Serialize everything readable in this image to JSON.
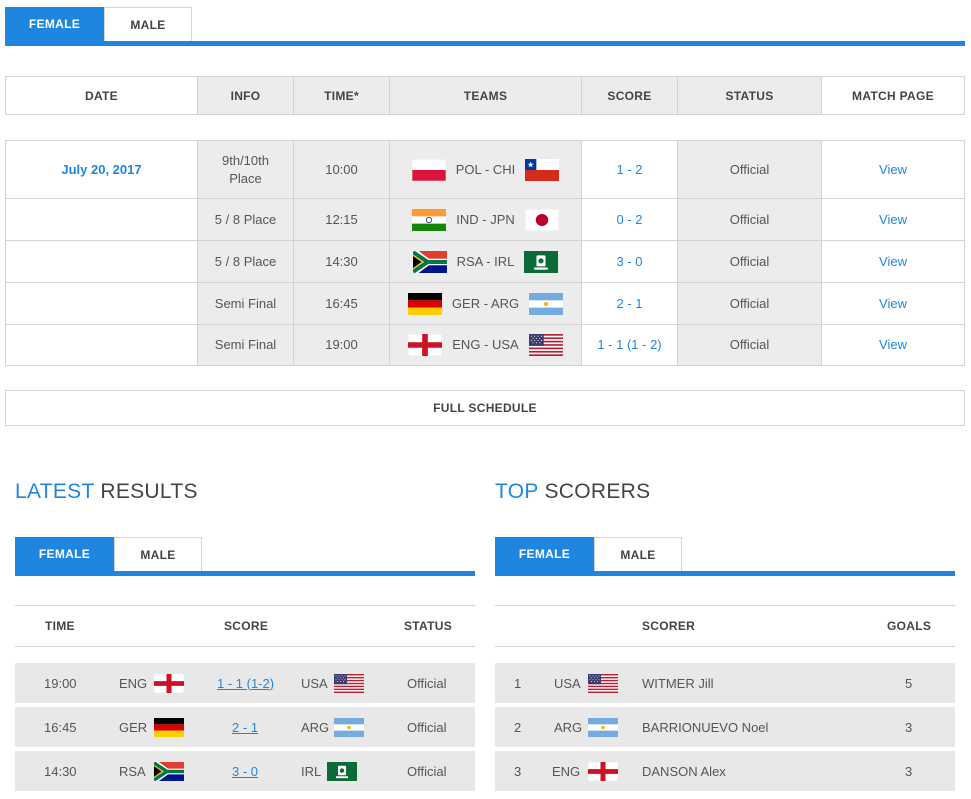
{
  "top_tabs": [
    "FEMALE",
    "MALE"
  ],
  "schedule": {
    "headers": [
      "DATE",
      "INFO",
      "TIME*",
      "TEAMS",
      "SCORE",
      "STATUS",
      "MATCH PAGE"
    ],
    "rows": [
      {
        "date": "July 20, 2017",
        "info": "9th/10th Place",
        "time": "10:00",
        "teams": "POL - CHI",
        "home_flag": "pol",
        "away_flag": "chi",
        "score": "1 - 2",
        "status": "Official",
        "link": "View"
      },
      {
        "date": "",
        "info": "5 / 8 Place",
        "time": "12:15",
        "teams": "IND - JPN",
        "home_flag": "ind",
        "away_flag": "jpn",
        "score": "0 - 2",
        "status": "Official",
        "link": "View"
      },
      {
        "date": "",
        "info": "5 / 8 Place",
        "time": "14:30",
        "teams": "RSA - IRL",
        "home_flag": "rsa",
        "away_flag": "irl",
        "score": "3 - 0",
        "status": "Official",
        "link": "View"
      },
      {
        "date": "",
        "info": "Semi Final",
        "time": "16:45",
        "teams": "GER - ARG",
        "home_flag": "ger",
        "away_flag": "arg",
        "score": "2 - 1",
        "status": "Official",
        "link": "View"
      },
      {
        "date": "",
        "info": "Semi Final",
        "time": "19:00",
        "teams": "ENG - USA",
        "home_flag": "eng",
        "away_flag": "usa",
        "score": "1 - 1 (1 - 2)",
        "status": "Official",
        "link": "View"
      }
    ],
    "full_schedule_label": "FULL SCHEDULE"
  },
  "latest_results": {
    "title_highlight": "LATEST",
    "title_rest": " RESULTS",
    "tabs": [
      "FEMALE",
      "MALE"
    ],
    "headers": [
      "TIME",
      "SCORE",
      "STATUS"
    ],
    "rows": [
      {
        "time": "19:00",
        "home": "ENG",
        "home_flag": "eng",
        "score": "1 - 1 (1-2)",
        "away": "USA",
        "away_flag": "usa",
        "status": "Official"
      },
      {
        "time": "16:45",
        "home": "GER",
        "home_flag": "ger",
        "score": "2 - 1",
        "away": "ARG",
        "away_flag": "arg",
        "status": "Official"
      },
      {
        "time": "14:30",
        "home": "RSA",
        "home_flag": "rsa",
        "score": "3 - 0",
        "away": "IRL",
        "away_flag": "irl",
        "status": "Official"
      }
    ]
  },
  "top_scorers": {
    "title_highlight": "TOP",
    "title_rest": " SCORERS",
    "tabs": [
      "FEMALE",
      "MALE"
    ],
    "headers": [
      "SCORER",
      "GOALS"
    ],
    "rows": [
      {
        "rank": "1",
        "team": "USA",
        "flag": "usa",
        "name": "WITMER Jill",
        "goals": "5"
      },
      {
        "rank": "2",
        "team": "ARG",
        "flag": "arg",
        "name": "BARRIONUEVO Noel",
        "goals": "3"
      },
      {
        "rank": "3",
        "team": "ENG",
        "flag": "eng",
        "name": "DANSON Alex",
        "goals": "3"
      }
    ]
  },
  "colors": {
    "accent": "#1f86e0",
    "row_grey": "#e8e8e8",
    "header_grey": "#ececec"
  }
}
